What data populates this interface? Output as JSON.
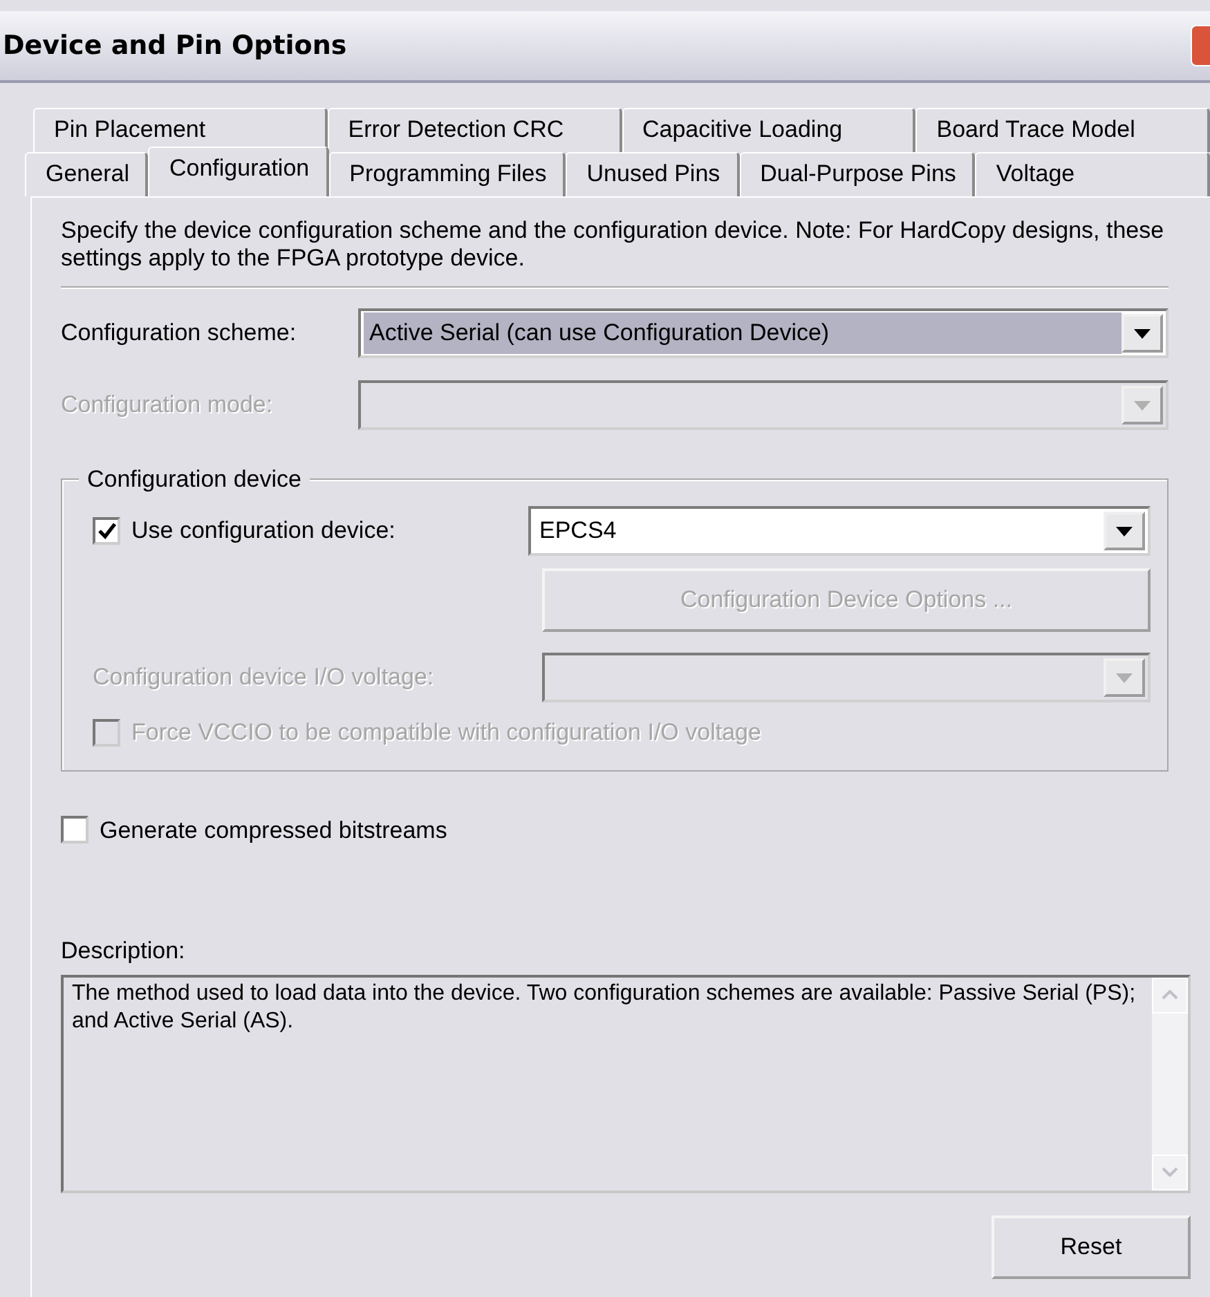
{
  "window": {
    "title": "Device and Pin Options"
  },
  "tab_rows": [
    [
      {
        "label": "Pin Placement",
        "selected": false
      },
      {
        "label": "Error Detection CRC",
        "selected": false
      },
      {
        "label": "Capacitive Loading",
        "selected": false
      },
      {
        "label": "Board Trace Model",
        "selected": false
      }
    ],
    [
      {
        "label": "General",
        "selected": false
      },
      {
        "label": "Configuration",
        "selected": true
      },
      {
        "label": "Programming Files",
        "selected": false
      },
      {
        "label": "Unused Pins",
        "selected": false
      },
      {
        "label": "Dual-Purpose Pins",
        "selected": false
      },
      {
        "label": "Voltage",
        "selected": false
      }
    ]
  ],
  "intro": "Specify the device configuration scheme and the configuration device. Note: For HardCopy designs, these settings apply to the FPGA prototype device.",
  "fields": [
    {
      "label": "Configuration scheme:",
      "value": "Active Serial (can use Configuration Device)",
      "selected": true,
      "disabled": false
    },
    {
      "label": "Configuration mode:",
      "disabled": true
    }
  ],
  "group": {
    "title": "Configuration device",
    "use_device": {
      "label": "Use configuration device:",
      "checked": true,
      "value": "EPCS4"
    },
    "options_button": {
      "label": "Configuration Device Options ...",
      "disabled": true
    },
    "io_voltage": {
      "label": "Configuration device I/O voltage:",
      "disabled": true
    },
    "force_vccio": {
      "label": "Force VCCIO to be compatible with configuration I/O voltage",
      "checked": false,
      "disabled": true
    }
  },
  "compressed": {
    "label": "Generate compressed bitstreams",
    "checked": false
  },
  "description": {
    "label": "Description:",
    "text": "The method used to load data into the device. Two configuration schemes are available:  Passive Serial (PS); and Active Serial (AS)."
  },
  "reset_button": {
    "label": "Reset"
  }
}
